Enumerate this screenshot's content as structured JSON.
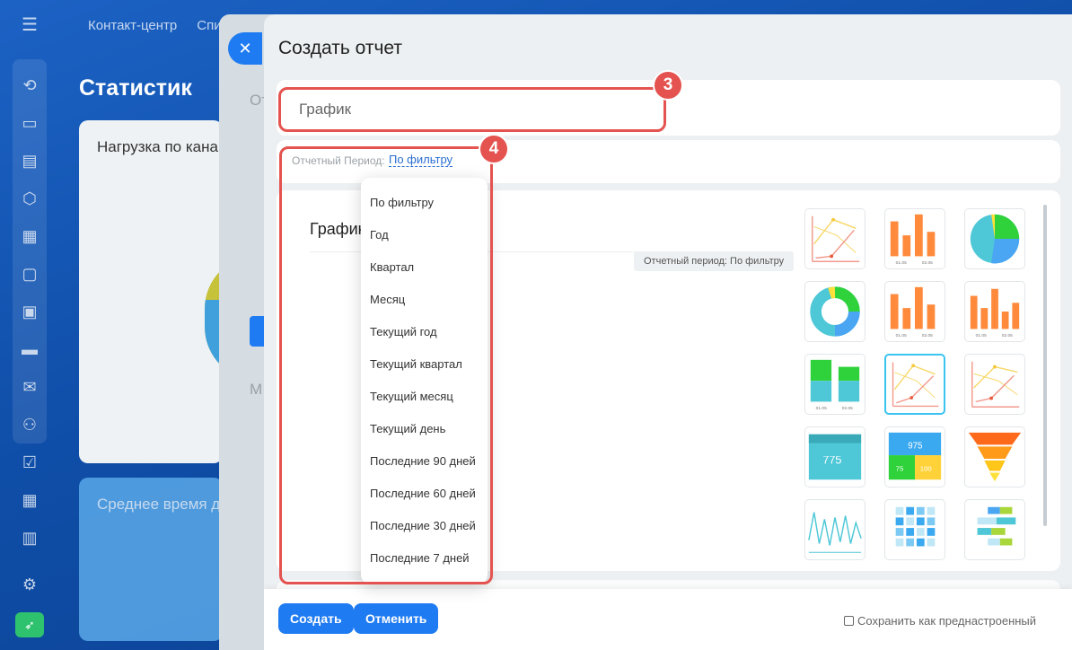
{
  "background": {
    "nav_items": [
      "Контакт-центр",
      "Спи"
    ],
    "page_title": "Статистик",
    "card1_title": "Нагрузка по кана",
    "card2_title": "Среднее время д",
    "underlay_text1": "От",
    "underlay_text2": "М"
  },
  "rail": {
    "icons": [
      "menu-icon",
      "activity-icon",
      "chat-icon",
      "document-icon",
      "hexagon-icon",
      "calendar-icon",
      "file-icon",
      "presentation-icon",
      "card-icon",
      "mail-icon",
      "users-icon",
      "checkbox-icon",
      "schedule-icon",
      "storage-icon",
      "settings-icon",
      "rocket-icon"
    ]
  },
  "panel": {
    "title": "Создать отчет",
    "name_value": "График",
    "period_label": "Отчетный Период:",
    "period_value": "По фильтру",
    "chart_heading": "График",
    "period_pill": "Отчетный период: По фильтру",
    "badge_name": "3",
    "badge_period": "4"
  },
  "dropdown": {
    "options": [
      "По фильтру",
      "Год",
      "Квартал",
      "Месяц",
      "Текущий год",
      "Текущий квартал",
      "Текущий месяц",
      "Текущий день",
      "Последние 90 дней",
      "Последние 60 дней",
      "Последние 30 дней",
      "Последние 7 дней"
    ]
  },
  "thumbnails": [
    "line-chart",
    "bar-chart",
    "pie-chart",
    "donut-chart",
    "bar-chart",
    "bar-chart",
    "stacked-bar-chart",
    "line-chart",
    "line-chart",
    "number-tile",
    "number-grid",
    "funnel-chart",
    "activity-line",
    "heatmap",
    "bar-matrix"
  ],
  "thumbnail_text": {
    "number_tile": "775",
    "number_grid_top": "975",
    "number_grid_left": "75",
    "number_grid_right": "100",
    "bar_label_1": "01.05",
    "bar_label_2": "02.05"
  },
  "footer": {
    "create_label": "Создать",
    "cancel_label": "Отменить",
    "save_preset_label": "Сохранить как преднастроенный"
  },
  "colors": {
    "accent_blue": "#1f7bf2",
    "highlight_red": "#e4534f",
    "chart_orange": "#ff8a3c",
    "chart_green": "#2fd23a",
    "chart_cyan": "#4ec7d7",
    "chart_yellow": "#ffe03a"
  }
}
